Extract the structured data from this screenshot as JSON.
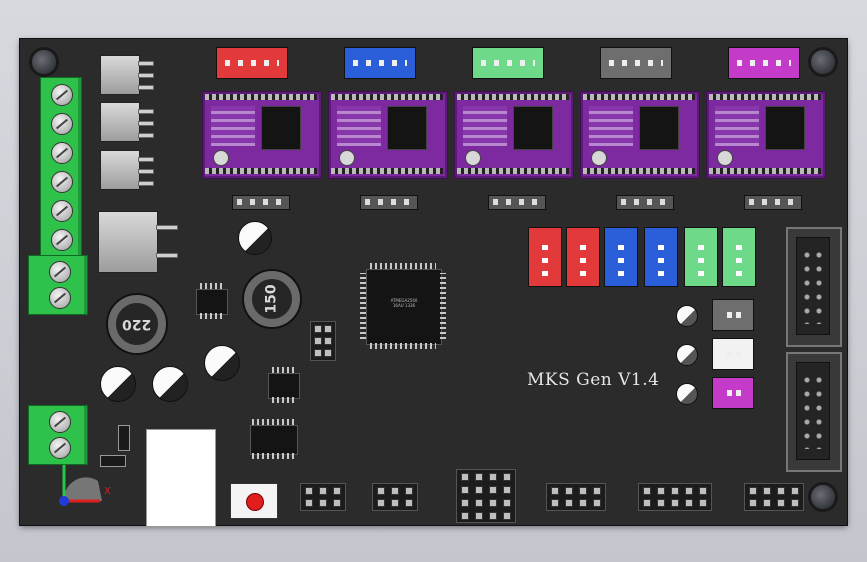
{
  "board": {
    "label": "MKS  Gen V1.4",
    "base_color": "#2b2b2b"
  },
  "inductors": [
    {
      "marking": "150"
    },
    {
      "marking": "220"
    }
  ],
  "motor_connectors": [
    {
      "color": "#e23a3a"
    },
    {
      "color": "#2b5fd9"
    },
    {
      "color": "#6fd98a"
    },
    {
      "color": "#6e6e6e"
    },
    {
      "color": "#c43ac9"
    }
  ],
  "endstop_connectors": [
    {
      "color": "#e23a3a"
    },
    {
      "color": "#e23a3a"
    },
    {
      "color": "#2b5fd9"
    },
    {
      "color": "#2b5fd9"
    },
    {
      "color": "#6fd98a"
    },
    {
      "color": "#6fd98a"
    }
  ],
  "fan_connectors": [
    {
      "color": "#6e6e6e"
    },
    {
      "color": "#f2f2f2"
    },
    {
      "color": "#c43ac9"
    }
  ],
  "axis": {
    "x_label": "X"
  },
  "icons": [
    "reset-button-icon",
    "coordinate-triad-icon"
  ]
}
